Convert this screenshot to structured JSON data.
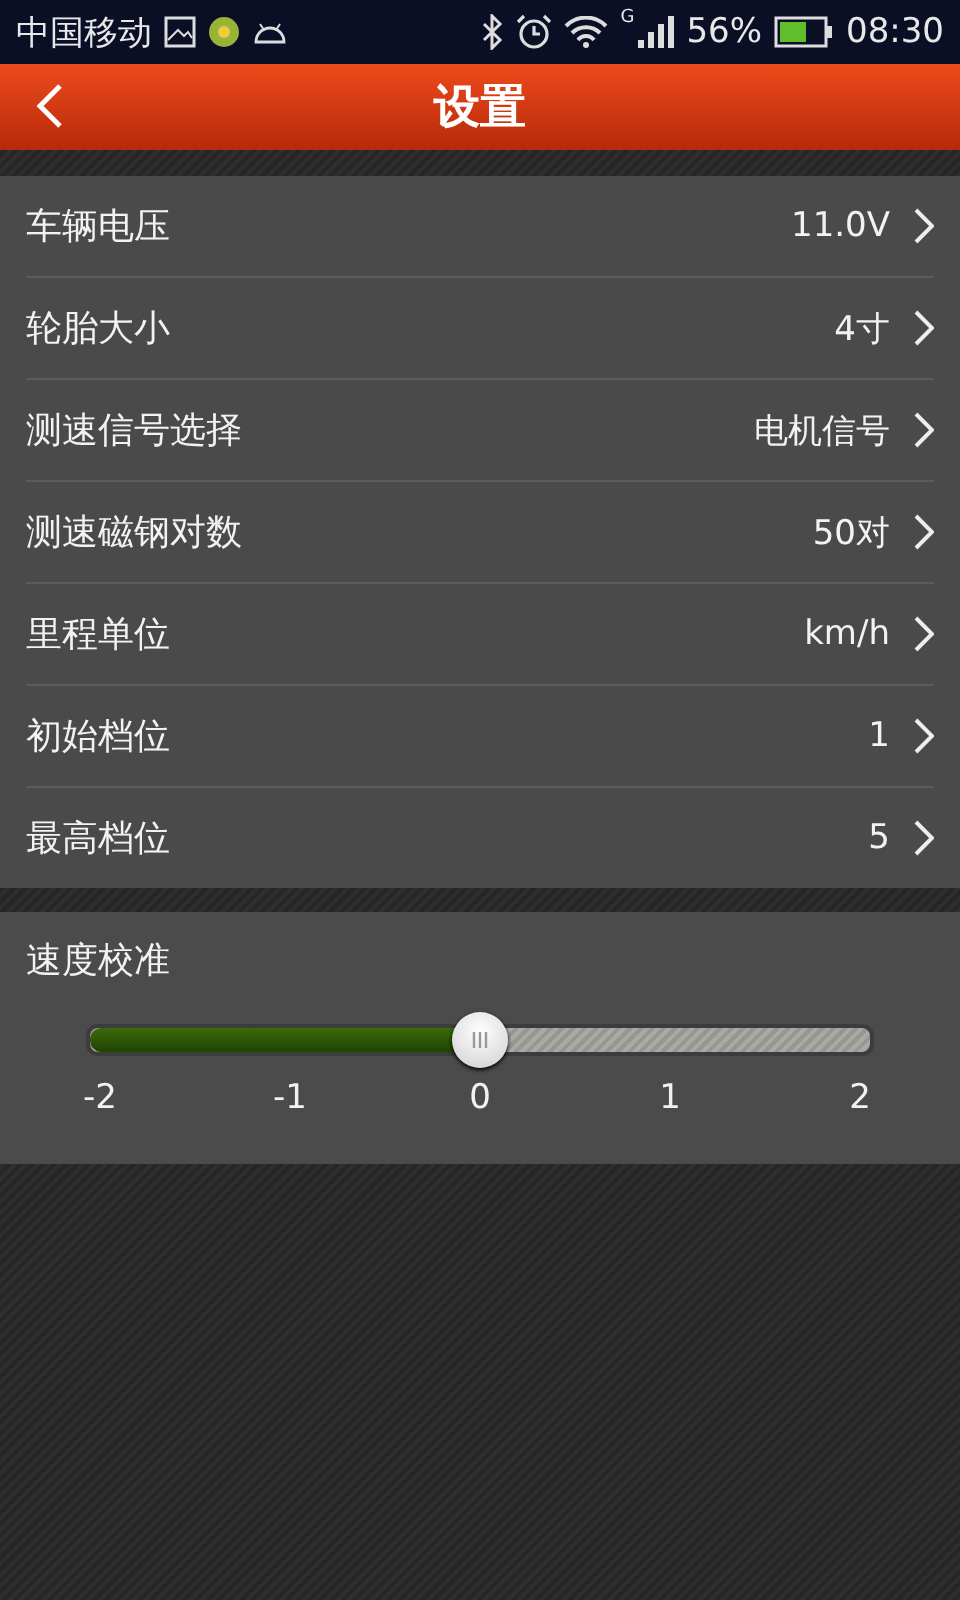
{
  "status_bar": {
    "carrier": "中国移动",
    "network": "G",
    "battery": "56%",
    "time": "08:30"
  },
  "header": {
    "title": "设置"
  },
  "settings": [
    {
      "label": "车辆电压",
      "value": "11.0V"
    },
    {
      "label": "轮胎大小",
      "value": "4寸"
    },
    {
      "label": "测速信号选择",
      "value": "电机信号"
    },
    {
      "label": "测速磁钢对数",
      "value": "50对"
    },
    {
      "label": "里程单位",
      "value": "km/h"
    },
    {
      "label": "初始档位",
      "value": "1"
    },
    {
      "label": "最高档位",
      "value": "5"
    }
  ],
  "calibration": {
    "title": "速度校准",
    "level": 0.5,
    "ticks": [
      "-2",
      "-1",
      "0",
      "1",
      "2"
    ]
  }
}
